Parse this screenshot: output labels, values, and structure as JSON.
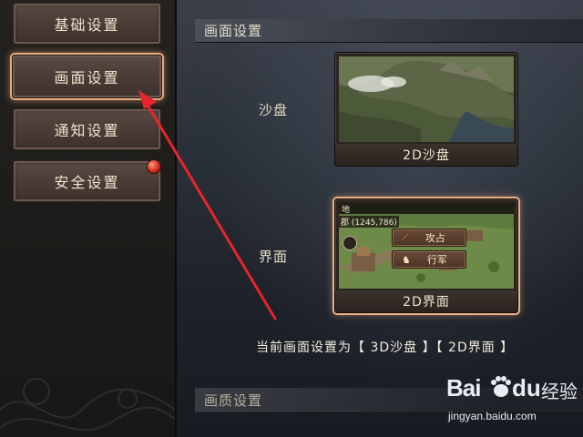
{
  "sidebar": {
    "items": [
      {
        "label": "基础设置",
        "active": false
      },
      {
        "label": "画面设置",
        "active": true
      },
      {
        "label": "通知设置",
        "active": false
      },
      {
        "label": "安全设置",
        "active": false,
        "has_badge": true
      }
    ]
  },
  "main": {
    "section_title": "画面设置",
    "rows": [
      {
        "label": "沙盘",
        "option_caption": "2D沙盘",
        "selected": false
      },
      {
        "label": "界面",
        "option_caption": "2D界面",
        "selected": true
      }
    ],
    "interface_preview": {
      "topbar_text": "地",
      "coords_text": "郡 (1245,786)",
      "attack_label": "攻占",
      "march_label": "行军"
    },
    "status_text": "当前画面设置为【 3D沙盘 】【 2D界面 】",
    "quality_section_title": "画质设置"
  },
  "watermark": {
    "brand": "Bai",
    "brand_suffix": "du",
    "product": "经验",
    "url": "jingyan.baidu.com"
  },
  "colors": {
    "highlight_glow": "#eab089",
    "annotation_arrow": "#e8242a",
    "badge_red": "#d62a1a"
  }
}
